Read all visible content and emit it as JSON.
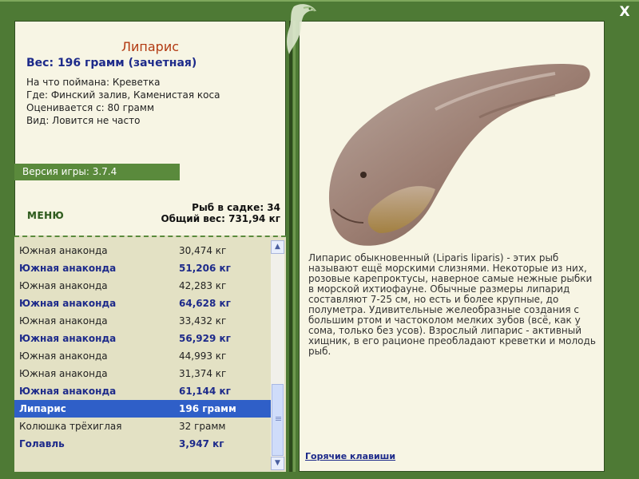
{
  "fish": {
    "title": "Липарис",
    "weight_line": "Вес: 196 грамм (зачетная)",
    "bait": "На что поймана: Креветка",
    "location": "Где: Финский залив, Каменистая коса",
    "rated_from": "Оценивается с: 80 грамм",
    "kind": "Вид: Ловится не часто",
    "description": "Липарис обыкновенный (Liparis liparis) - этих рыб называют ещё морскими слизнями. Некоторые из них, розовые карепроктусы, наверное самые нежные рыбки в морской ихтиофауне. Обычные размеры липарид составляют 7-25 см, но есть и более крупные, до полуметра. Удивительные желеобразные создания с большим ртом и частоколом мелких зубов (всё, как у сома, только без усов). Взрослый липарис - активный хищник, в его рационе преобладают креветки и молодь рыб."
  },
  "version": "Версия игры: 3.7.4",
  "menu_label": "МЕНЮ",
  "stats": {
    "in_keepnet": "Рыб в садке: 34",
    "total_weight": "Общий вес: 731,94 кг"
  },
  "catch_list": [
    {
      "name": "Южная анаконда",
      "weight": "30,474 кг",
      "style": "normal"
    },
    {
      "name": "Южная анаконда",
      "weight": "51,206 кг",
      "style": "bold"
    },
    {
      "name": "Южная анаконда",
      "weight": "42,283 кг",
      "style": "normal"
    },
    {
      "name": "Южная анаконда",
      "weight": "64,628 кг",
      "style": "bold"
    },
    {
      "name": "Южная анаконда",
      "weight": "33,432 кг",
      "style": "normal"
    },
    {
      "name": "Южная анаконда",
      "weight": "56,929 кг",
      "style": "bold"
    },
    {
      "name": "Южная анаконда",
      "weight": "44,993 кг",
      "style": "normal"
    },
    {
      "name": "Южная анаконда",
      "weight": "31,374 кг",
      "style": "normal"
    },
    {
      "name": "Южная анаконда",
      "weight": "61,144 кг",
      "style": "bold"
    },
    {
      "name": "Липарис",
      "weight": "196 грамм",
      "style": "selected"
    },
    {
      "name": "Колюшка трёхиглая",
      "weight": "32 грамм",
      "style": "normal"
    },
    {
      "name": "Голавль",
      "weight": "3,947 кг",
      "style": "bold"
    }
  ],
  "hotkeys_label": "Горячие клавиши",
  "close_label": "X",
  "scroll_up": "▲",
  "scroll_down": "▼",
  "colors": {
    "frame": "#4e7a35",
    "panel": "#f7f5e4",
    "title": "#b23a12",
    "accent_text": "#1d2a8a",
    "selection": "#2f5fc8"
  },
  "icons": {
    "close": "close-icon",
    "emblem": "fish-emblem-icon",
    "scroll_up": "arrow-up-icon",
    "scroll_down": "arrow-down-icon"
  }
}
